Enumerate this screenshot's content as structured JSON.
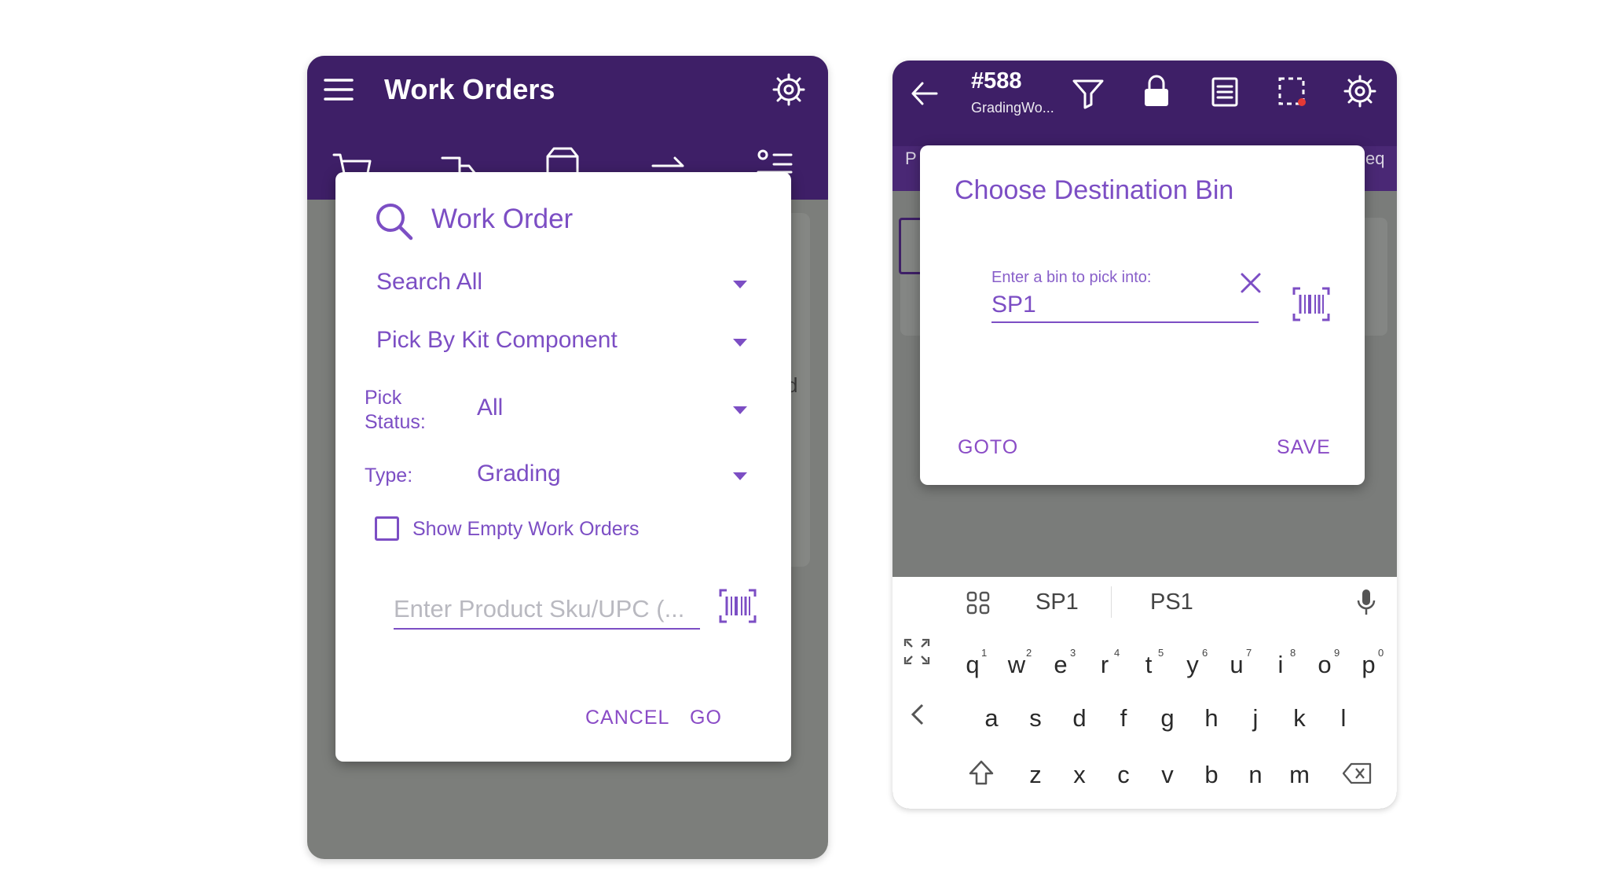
{
  "left": {
    "title": "Work Orders",
    "dialog": {
      "title": "Work Order",
      "search_scope": "Search All",
      "pick_mode": "Pick By Kit Component",
      "pick_status_label": "Pick\nStatus:",
      "pick_status_value": "All",
      "type_label": "Type:",
      "type_value": "Grading",
      "checkbox_label": "Show Empty Work Orders",
      "sku_placeholder": "Enter Product Sku/UPC (...",
      "cancel": "CANCEL",
      "go": "GO"
    },
    "bg_fragment_d": "d"
  },
  "right": {
    "order_number": "#588",
    "order_subtitle": "GradingWo...",
    "sub_left": "P",
    "sub_right": "eq",
    "dialog": {
      "title": "Choose Destination Bin",
      "field_label": "Enter a bin to pick into:",
      "field_value": "SP1",
      "goto": "GOTO",
      "save": "SAVE"
    },
    "keyboard": {
      "suggestions": [
        "SP1",
        "PS1"
      ],
      "row1": [
        "q",
        "w",
        "e",
        "r",
        "t",
        "y",
        "u",
        "i",
        "o",
        "p"
      ],
      "row1_nums": [
        "1",
        "2",
        "3",
        "4",
        "5",
        "6",
        "7",
        "8",
        "9",
        "0"
      ],
      "row2": [
        "a",
        "s",
        "d",
        "f",
        "g",
        "h",
        "j",
        "k",
        "l"
      ],
      "row3": [
        "z",
        "x",
        "c",
        "v",
        "b",
        "n",
        "m"
      ]
    }
  },
  "colors": {
    "header": "#3e1f67",
    "accent": "#7c4ec4",
    "overlay": "#7c7e7b"
  }
}
